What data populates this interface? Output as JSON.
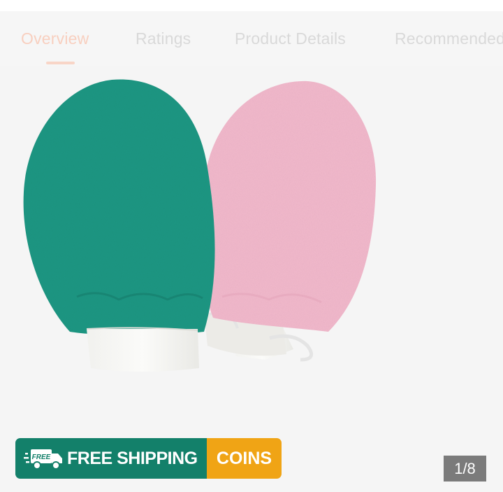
{
  "tabs": [
    {
      "label": "Overview",
      "active": true
    },
    {
      "label": "Ratings",
      "active": false
    },
    {
      "label": "Product Details",
      "active": false
    },
    {
      "label": "Recommended",
      "active": false
    }
  ],
  "gallery": {
    "image_alt": "Pair of exfoliating bath mitts, teal and pink",
    "counter": "1/8"
  },
  "banner": {
    "badge_text": "FREE",
    "shipping_label": "FREE SHIPPING",
    "coins_label": "COINS",
    "shipping_color": "#13806a",
    "coins_color": "#f0a415"
  },
  "colors": {
    "tab_active": "#f8cfbf",
    "tab_inactive": "#d9d9d9",
    "mitt_teal": "#1f9783",
    "mitt_pink": "#f2b9cc"
  }
}
